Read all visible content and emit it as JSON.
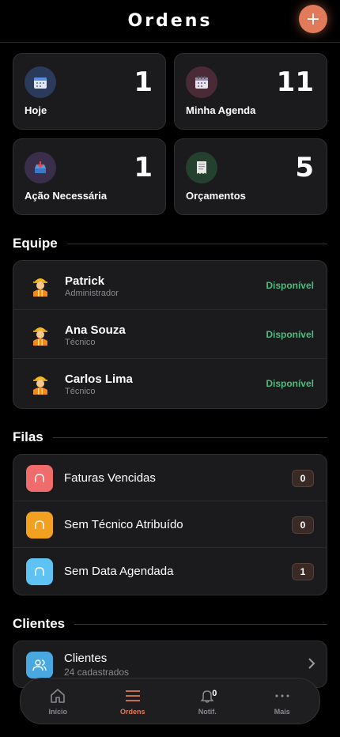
{
  "header": {
    "title": "Ordens",
    "add_label": "+"
  },
  "stats": [
    {
      "value": "1",
      "label": "Hoje",
      "icon": "calendar-icon",
      "color": "#2a3a5a"
    },
    {
      "value": "11",
      "label": "Minha Agenda",
      "icon": "spiral-calendar-icon",
      "color": "#4a2a34"
    },
    {
      "value": "1",
      "label": "Ação Necessária",
      "icon": "inbox-tray-icon",
      "color": "#3a2e4a"
    },
    {
      "value": "5",
      "label": "Orçamentos",
      "icon": "receipt-icon",
      "color": "#24402e"
    }
  ],
  "team": {
    "title": "Equipe",
    "members": [
      {
        "name": "Patrick",
        "role": "Administrador",
        "status": "Disponível"
      },
      {
        "name": "Ana Souza",
        "role": "Técnico",
        "status": "Disponível"
      },
      {
        "name": "Carlos Lima",
        "role": "Técnico",
        "status": "Disponível"
      }
    ],
    "status_color": "#4ebc7e"
  },
  "queues": {
    "title": "Filas",
    "items": [
      {
        "label": "Faturas Vencidas",
        "count": "0",
        "color": "#f06b6b"
      },
      {
        "label": "Sem Técnico Atribuído",
        "count": "0",
        "color": "#f2a020"
      },
      {
        "label": "Sem Data Agendada",
        "count": "1",
        "color": "#5ec2f2"
      }
    ]
  },
  "clients": {
    "title": "Clientes",
    "label": "Clientes",
    "subtitle": "24 cadastrados"
  },
  "nav": {
    "items": [
      {
        "label": "Início",
        "icon": "home-icon"
      },
      {
        "label": "Ordens",
        "icon": "menu-icon",
        "active": true
      },
      {
        "label": "Notif.",
        "icon": "bell-icon",
        "badge": "0"
      },
      {
        "label": "Mais",
        "icon": "more-icon"
      }
    ]
  },
  "accent": "#e07a5a"
}
